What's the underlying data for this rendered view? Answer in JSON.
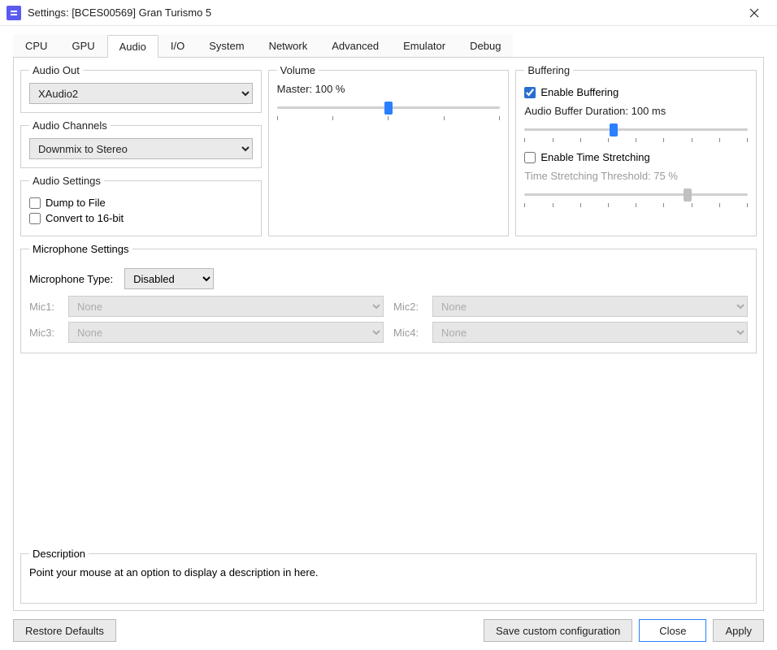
{
  "window": {
    "title": "Settings: [BCES00569] Gran Turismo 5"
  },
  "tabs": [
    "CPU",
    "GPU",
    "Audio",
    "I/O",
    "System",
    "Network",
    "Advanced",
    "Emulator",
    "Debug"
  ],
  "activeTab": "Audio",
  "audioOut": {
    "legend": "Audio Out",
    "value": "XAudio2"
  },
  "audioChannels": {
    "legend": "Audio Channels",
    "value": "Downmix to Stereo"
  },
  "audioSettings": {
    "legend": "Audio Settings",
    "dumpToFile": {
      "label": "Dump to File",
      "checked": false
    },
    "convert16bit": {
      "label": "Convert to 16-bit",
      "checked": false
    }
  },
  "volume": {
    "legend": "Volume",
    "masterLabel": "Master: 100 %",
    "masterPct": 50
  },
  "buffering": {
    "legend": "Buffering",
    "enableBuffering": {
      "label": "Enable Buffering",
      "checked": true
    },
    "durationLabel": "Audio Buffer Duration: 100 ms",
    "durationPct": 40,
    "enableTimeStretch": {
      "label": "Enable Time Stretching",
      "checked": false
    },
    "thresholdLabel": "Time Stretching Threshold: 75 %",
    "thresholdPct": 73
  },
  "microphone": {
    "legend": "Microphone Settings",
    "typeLabel": "Microphone Type:",
    "typeValue": "Disabled",
    "mic1Label": "Mic1:",
    "mic1Value": "None",
    "mic2Label": "Mic2:",
    "mic2Value": "None",
    "mic3Label": "Mic3:",
    "mic3Value": "None",
    "mic4Label": "Mic4:",
    "mic4Value": "None"
  },
  "description": {
    "legend": "Description",
    "text": "Point your mouse at an option to display a description in here."
  },
  "buttons": {
    "restore": "Restore Defaults",
    "saveCustom": "Save custom configuration",
    "close": "Close",
    "apply": "Apply"
  }
}
